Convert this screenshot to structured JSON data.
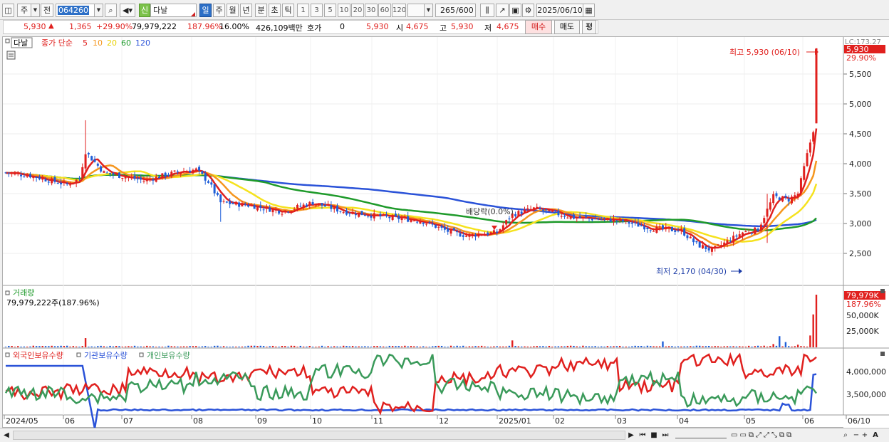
{
  "toolbar": {
    "market_label": "주",
    "prev_label": "전",
    "code": "064260",
    "new_tag": "신",
    "stock_name": "다날",
    "periods": [
      "일",
      "주",
      "월",
      "년",
      "분",
      "초",
      "틱"
    ],
    "minutes": [
      "1",
      "3",
      "5",
      "10",
      "20",
      "30",
      "60",
      "120"
    ],
    "count_display": "265",
    "count_max": "/600",
    "date": "2025/06/10"
  },
  "info": {
    "price": "5,930",
    "change": "1,365",
    "change_pct": "+29.90%",
    "volume": "79,979,222",
    "volume_ratio": "187.96%",
    "turnover": "16.00%",
    "amount": "426,109백만",
    "quote_label": "호가",
    "quote_value": "0",
    "quote_price": "5,930",
    "open_label": "시",
    "open": "4,675",
    "high_label": "고",
    "high": "5,930",
    "low_label": "저",
    "low": "4,675",
    "buy_label": "매수",
    "sell_label": "매도",
    "eval_label": "평"
  },
  "price_panel": {
    "stock_tag": "다날",
    "legend_main": "종가 단순",
    "ma_labels": [
      "5",
      "10",
      "20",
      "60",
      "120"
    ],
    "corner_label": "LC:173.27",
    "last_price_tag": "5,930",
    "last_pct_tag": "29.90%",
    "high_annotation": "최고 5,930 (06/10)",
    "low_annotation": "최저 2,170 (04/30)",
    "dividend_annotation": "배당락(0.0%)",
    "y_ticks": [
      "5,500",
      "5,000",
      "4,500",
      "4,000",
      "3,500",
      "3,000",
      "2,500"
    ]
  },
  "volume_panel": {
    "title": "거래량",
    "value_line": "79,979,222주(187.96%)",
    "last_tag": "79,979K",
    "last_pct": "187.96%",
    "y_ticks": [
      "50,000K",
      "25,000K"
    ]
  },
  "holdings_panel": {
    "legend": [
      "외국인보유수량",
      "기관보유수량",
      "개인보유수량"
    ],
    "y_ticks": [
      "4,000,000",
      "3,500,000"
    ]
  },
  "x_axis": {
    "labels": [
      "2024/05",
      "06",
      "07",
      "08",
      "09",
      "10",
      "11",
      "12",
      "2025/01",
      "02",
      "03",
      "04",
      "05",
      "06",
      "06/10"
    ]
  },
  "colors": {
    "candle_up": "#e0201e",
    "candle_down": "#1e5ed8",
    "ma5": "#e0201e",
    "ma10": "#f5961e",
    "ma20": "#f5e21e",
    "ma60": "#1e9a2a",
    "ma120": "#2a52d8",
    "foreign": "#e0201e",
    "institution": "#2a52d8",
    "individual": "#3a9a5a"
  }
}
